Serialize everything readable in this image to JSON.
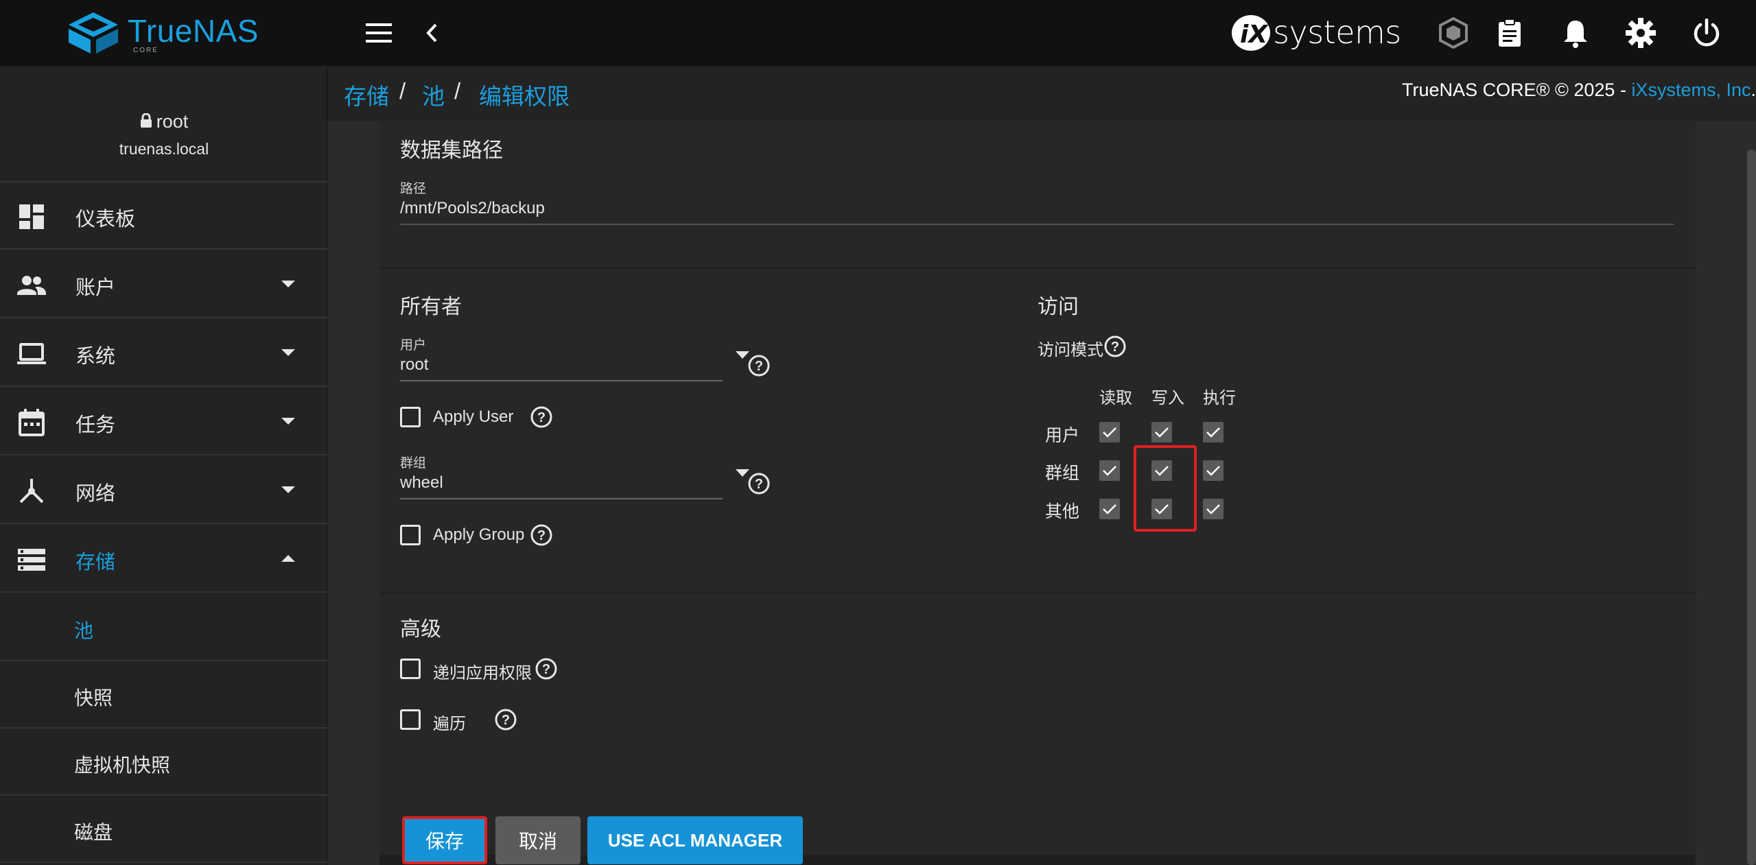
{
  "brand": {
    "name": "TrueNAS",
    "edition": "CORE",
    "partner": "systems"
  },
  "user": {
    "name": "root",
    "host": "truenas.local"
  },
  "sidebar": {
    "items": [
      {
        "label": "仪表板"
      },
      {
        "label": "账户"
      },
      {
        "label": "系统"
      },
      {
        "label": "任务"
      },
      {
        "label": "网络"
      },
      {
        "label": "存储"
      }
    ],
    "sub_items": [
      {
        "label": "池"
      },
      {
        "label": "快照"
      },
      {
        "label": "虚拟机快照"
      },
      {
        "label": "磁盘"
      }
    ]
  },
  "breadcrumb": {
    "items": [
      "存储",
      "池",
      "编辑权限"
    ],
    "separator": "/"
  },
  "copyright": {
    "prefix": "TrueNAS CORE® © 2025 - ",
    "link": "iXsystems, Inc",
    "suffix": "."
  },
  "dataset": {
    "title": "数据集路径",
    "path_label": "路径",
    "path_value": "/mnt/Pools2/backup"
  },
  "owner": {
    "title": "所有者",
    "user_label": "用户",
    "user_value": "root",
    "apply_user_label": "Apply User",
    "apply_user_checked": false,
    "group_label": "群组",
    "group_value": "wheel",
    "apply_group_label": "Apply Group",
    "apply_group_checked": false
  },
  "access": {
    "title": "访问",
    "mode_label": "访问模式",
    "columns": [
      "读取",
      "写入",
      "执行"
    ],
    "rows": [
      {
        "label": "用户",
        "read": true,
        "write": true,
        "execute": true
      },
      {
        "label": "群组",
        "read": true,
        "write": true,
        "execute": true
      },
      {
        "label": "其他",
        "read": true,
        "write": true,
        "execute": true
      }
    ]
  },
  "advanced": {
    "title": "高级",
    "recursive_label": "递归应用权限",
    "recursive_checked": false,
    "traverse_label": "遍历",
    "traverse_checked": false
  },
  "actions": {
    "save": "保存",
    "cancel": "取消",
    "acl": "USE ACL MANAGER"
  },
  "colors": {
    "accent": "#1a9fdd",
    "highlight": "#e02020",
    "background": "#2b2b2b",
    "sidebar": "#232323"
  }
}
